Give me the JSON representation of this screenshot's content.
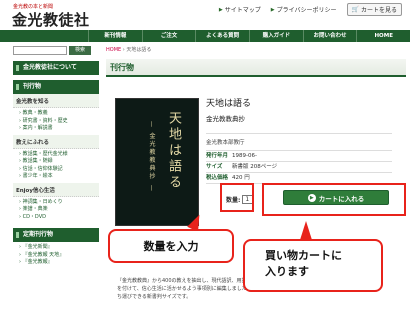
{
  "header": {
    "tagline": "金光教の本と新聞",
    "brand": "金光教徒社",
    "links": [
      {
        "label": "サイトマップ"
      },
      {
        "label": "プライバシーポリシー"
      }
    ],
    "cart_label": "カートを見る"
  },
  "nav": {
    "items": [
      "新刊情報",
      "ご注文",
      "よくある質問",
      "購入ガイド",
      "お問い合わせ",
      "HOME"
    ]
  },
  "sidebar": {
    "search_button": "検索",
    "about_label": "金光教徒社について",
    "publications_label": "刊行物",
    "sections": [
      {
        "title": "金光教を知る",
        "items": [
          "教典・教義",
          "研究書・資料・歴史",
          "案内・解説書"
        ]
      },
      {
        "title": "教えにふれる",
        "items": [
          "教話集・歴代金光様",
          "教話集・随録",
          "信話・信仰体験記",
          "書少年・絵本"
        ]
      },
      {
        "title": "Enjoy信心生活",
        "items": [
          "神詞集・日めくり",
          "楽譜・典楽",
          "CD・DVD"
        ]
      },
      {
        "title": "定期刊行物",
        "items": [
          "『金光新聞』",
          "『金光教報 天地』",
          "『金光教報』"
        ]
      }
    ]
  },
  "main": {
    "breadcrumb_home": "HOME",
    "breadcrumb_current": "天地は語る",
    "page_title": "刊行物",
    "book_cover_title": "天地は語る",
    "book_cover_subtitle": "— 金光教教典抄 —",
    "title": "天地は語る",
    "subtitle": "金光教教典抄",
    "author": "金光教本部教庁",
    "specs": [
      {
        "key": "発行年月",
        "value": "1989-06-"
      },
      {
        "key": "サイズ",
        "value": "新書版 208ページ"
      },
      {
        "key": "税込価格",
        "value": "420 円"
      }
    ],
    "qty_label": "数量:",
    "qty_value": "1",
    "add_to_cart": "カートに入れる",
    "description": "『金光教教典』から400の教えを抽出し、現代語訳、用語解説を付けて、信心生活に活かせるよう事項別に編集しました。持ち運びできる新書判サイズです。"
  },
  "callouts": {
    "quantity": "数量を入力",
    "cart_line1": "買い物カートに",
    "cart_line2": "入ります"
  }
}
